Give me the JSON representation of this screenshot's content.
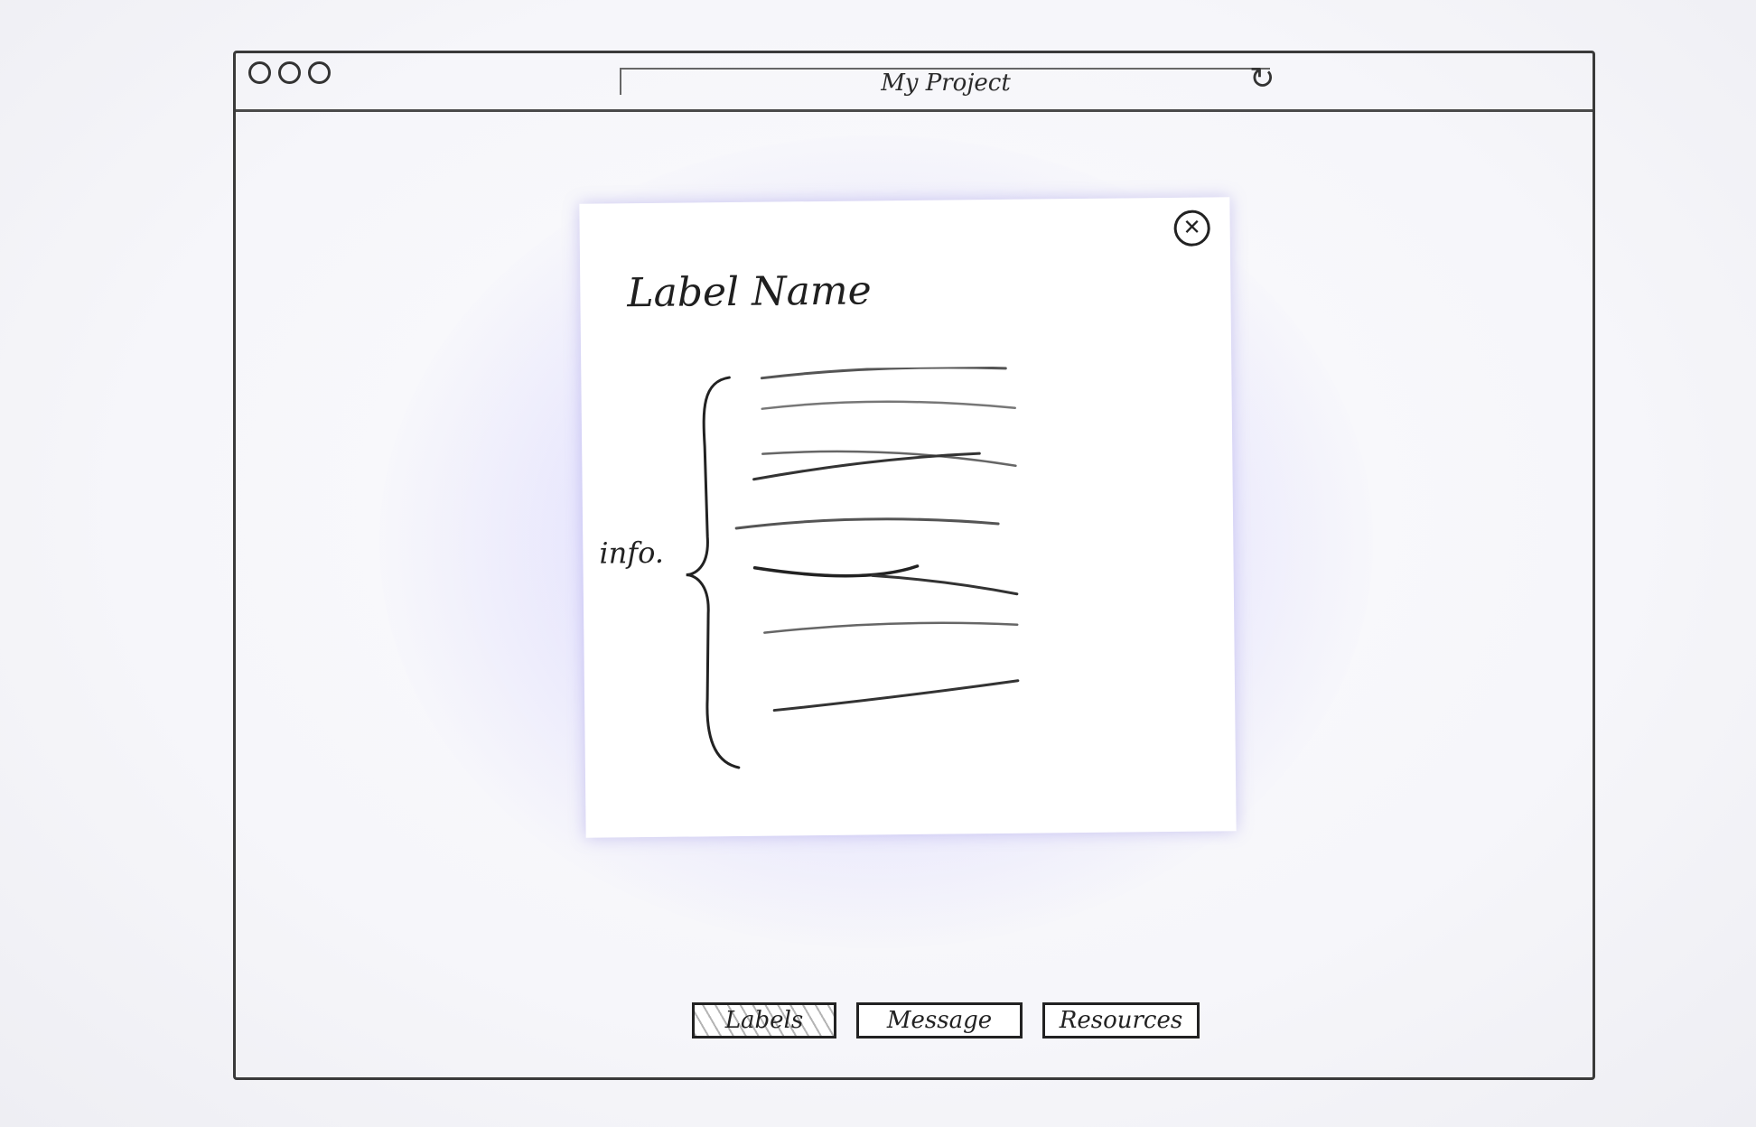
{
  "window": {
    "title": "My Project"
  },
  "modal": {
    "title": "Label Name",
    "info_label": "info."
  },
  "tabs": [
    {
      "label": "Labels",
      "selected": true
    },
    {
      "label": "Message",
      "selected": false
    },
    {
      "label": "Resources",
      "selected": false
    }
  ],
  "icons": {
    "reload": "reload-icon",
    "close": "close-icon"
  }
}
